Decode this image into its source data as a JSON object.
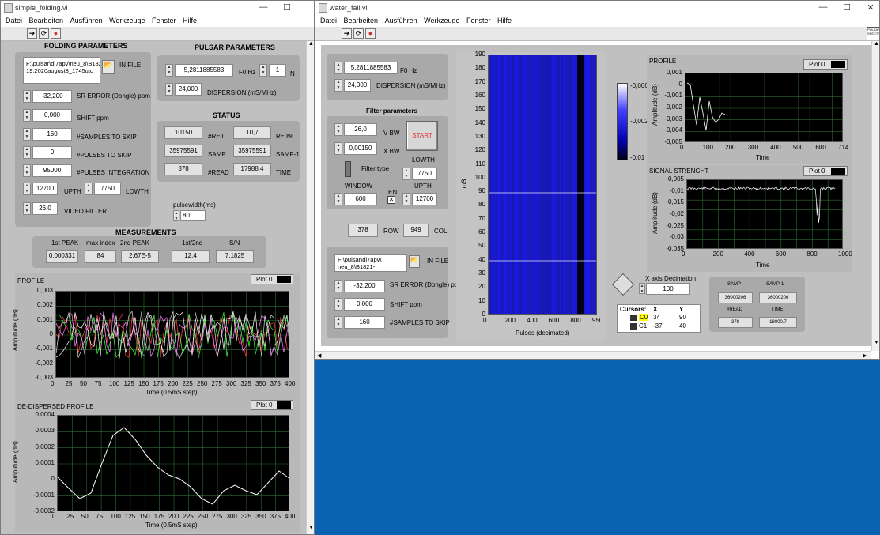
{
  "left_window": {
    "title": "simple_folding.vi",
    "menu": [
      "Datei",
      "Bearbeiten",
      "Ausführen",
      "Werkzeuge",
      "Fenster",
      "Hilfe"
    ],
    "folding": {
      "title": "FOLDING PARAMETERS",
      "in_file_value": "F:\\pulsar\\dl7apv\\neu_8\\B1821-\n19.2020august8_1745utc",
      "in_file_label": "IN FILE",
      "sr_error_value": "-32,200",
      "sr_error_label": "SR ERROR (Dongle) ppm",
      "shift_value": "0,000",
      "shift_label": "SHIFT ppm",
      "samples_skip_value": "160",
      "samples_skip_label": "#SAMPLES TO SKIP",
      "pulses_skip_value": "0",
      "pulses_skip_label": "#PULSES TO SKIP",
      "pulses_int_value": "95000",
      "pulses_int_label": "#PULSES INTEGRATION",
      "upth_value": "12700",
      "upth_label": "UPTH",
      "lowth_value": "7750",
      "lowth_label": "LOWTH",
      "video_value": "26,0",
      "video_label": "VIDEO FILTER"
    },
    "pulsar": {
      "title": "PULSAR PARAMETERS",
      "f0_value": "5,2811885583",
      "f0_label": "F0 Hz",
      "n_value": "1",
      "n_label": "N",
      "dispersion_value": "24,000",
      "dispersion_label": "DISPERSION (mS/MHz)"
    },
    "status": {
      "title": "STATUS",
      "rej_value": "10150",
      "rej_label": "#REJ",
      "rejp_value": "10,7",
      "rejp_label": "REJ%",
      "samp_value": "35975591",
      "samp_label": "SAMP",
      "samp1_value": "35975591",
      "samp1_label": "SAMP-1",
      "read_value": "378",
      "read_label": "#READ",
      "time_value": "17988,4",
      "time_label": "TIME"
    },
    "pulsewidth_label": "pulsewidth(ms)",
    "pulsewidth_value": "80",
    "measurements": {
      "title": "MEASUREMENTS",
      "peak1_label": "1st PEAK",
      "peak1_value": "0,000331",
      "maxidx_label": "max index",
      "maxidx_value": "84",
      "peak2_label": "2nd PEAK",
      "peak2_value": "2,67E-5",
      "ratio_label": "1st/2nd",
      "ratio_value": "12,4",
      "sn_label": "S/N",
      "sn_value": "7,1825"
    },
    "profile": {
      "title": "PROFILE",
      "legend": "Plot 0",
      "ylabel": "Amplitude (dB)",
      "xlabel": "Time (0.5mS step)",
      "yticks": [
        "0,003",
        "0,002",
        "0,001",
        "0",
        "-0,001",
        "-0,002",
        "-0,003"
      ],
      "xticks": [
        "0",
        "25",
        "50",
        "75",
        "100",
        "125",
        "150",
        "175",
        "200",
        "225",
        "250",
        "275",
        "300",
        "325",
        "350",
        "375",
        "400"
      ]
    },
    "dedispersed": {
      "title": "DE-DISPERSED PROFILE",
      "legend": "Plot 0",
      "ylabel": "Amplitude (dB)",
      "xlabel": "Time (0.5mS step)",
      "yticks": [
        "0,0004",
        "0,0003",
        "0,0002",
        "0,0001",
        "0",
        "-0,0001",
        "-0,0002"
      ],
      "xticks": [
        "0",
        "25",
        "50",
        "75",
        "100",
        "125",
        "150",
        "175",
        "200",
        "225",
        "250",
        "275",
        "300",
        "325",
        "350",
        "375",
        "400"
      ]
    }
  },
  "right_window": {
    "title": "water_fall.vi",
    "menu": [
      "Datei",
      "Bearbeiten",
      "Ausführen",
      "Werkzeuge",
      "Fenster",
      "Hilfe"
    ],
    "badge": "PULSAR\nSPECTR",
    "f0_value": "5,2811885583",
    "f0_label": "F0 Hz",
    "dispersion_value": "24,000",
    "dispersion_label": "DISPERSION (mS/MHz)",
    "filter": {
      "title": "Filter parameters",
      "vbw_value": "26,0",
      "vbw_label": "V BW",
      "xbw_value": "0,00150",
      "xbw_label": "X BW",
      "filter_type_label": "Filter type",
      "start_label": "START",
      "lowth_label": "LOWTH",
      "lowth_value": "7750",
      "window_label": "WINDOW",
      "window_value": "600",
      "en_label": "EN",
      "upth_label": "UPTH",
      "upth_value": "12700"
    },
    "row_value": "378",
    "row_label": "ROW",
    "col_value": "949",
    "col_label": "COL",
    "in_file_value": "F:\\pulsar\\dl7apv\\\nneu_8\\B1821-",
    "in_file_label": "IN FILE",
    "sr_error_value": "-32,200",
    "sr_error_label": "SR ERROR (Dongle) ppm",
    "shift_value": "0,000",
    "shift_label": "SHIFT ppm",
    "samples_skip_value": "160",
    "samples_skip_label": "#SAMPLES TO SKIP",
    "waterfall": {
      "ylabel": "mS",
      "xlabel": "Pulses (decimated)",
      "yticks": [
        "190",
        "180",
        "170",
        "160",
        "150",
        "140",
        "130",
        "120",
        "110",
        "100",
        "90",
        "80",
        "70",
        "60",
        "50",
        "40",
        "30",
        "20",
        "10",
        "0"
      ],
      "xticks": [
        "0",
        "200",
        "400",
        "600",
        "800",
        "950"
      ],
      "colorbar_ticks": [
        "-0,006",
        "-0,002",
        "-0,01"
      ]
    },
    "profile": {
      "title": "PROFILE",
      "legend": "Plot 0",
      "ylabel": "Amplitude (dB)",
      "xlabel": "Time",
      "yticks": [
        "0,001",
        "0",
        "-0,001",
        "-0,002",
        "-0,003",
        "-0,004",
        "-0,005"
      ],
      "xticks": [
        "0",
        "100",
        "200",
        "300",
        "400",
        "500",
        "600",
        "714"
      ]
    },
    "signal": {
      "title": "SIGNAL STRENGHT",
      "legend": "Plot 0",
      "ylabel": "Amplitude (dB)",
      "xlabel": "Time",
      "yticks": [
        "-0,005",
        "-0,01",
        "-0,015",
        "-0,02",
        "-0,025",
        "-0,03",
        "-0,035"
      ],
      "xticks": [
        "0",
        "200",
        "400",
        "600",
        "800",
        "1000"
      ]
    },
    "decimation_label": "X axis Decimation",
    "decimation_value": "100",
    "cursors": {
      "header": [
        "Cursors:",
        "X",
        "Y"
      ],
      "rows": [
        [
          "C0",
          "34",
          "90"
        ],
        [
          "C1",
          "-37",
          "40"
        ]
      ]
    },
    "status": {
      "samp_label": "SAMP",
      "samp_value": "36000206",
      "samp1_label": "SAMP-1",
      "samp1_value": "36000206",
      "read_label": "#READ",
      "read_value": "378",
      "time_label": "TIME",
      "time_value": "18000.7"
    }
  }
}
